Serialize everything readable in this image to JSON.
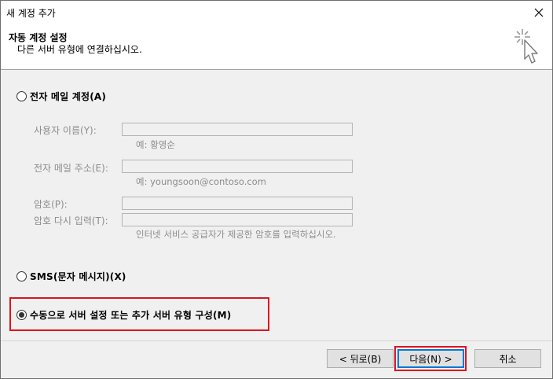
{
  "window": {
    "title": "새 계정 추가"
  },
  "header": {
    "title": "자동 계정 설정",
    "subtitle": "다른 서버 유형에 연결하십시오."
  },
  "options": {
    "email_label": "전자 메일 계정(A)",
    "sms_label": "SMS(문자 메시지)(X)",
    "manual_label": "수동으로 서버 설정 또는 추가 서버 유형 구성(M)",
    "selected": "manual"
  },
  "fields": {
    "username_label": "사용자 이름(Y):",
    "username_hint": "예: 황영순",
    "email_label": "전자 메일 주소(E):",
    "email_hint": "예: youngsoon@contoso.com",
    "password_label": "암호(P):",
    "retype_label": "암호 다시 입력(T):",
    "password_hint": "인터넷 서비스 공급자가 제공한 암호를 입력하십시오."
  },
  "buttons": {
    "back": "< 뒤로(B)",
    "next": "다음(N) >",
    "cancel": "취소"
  },
  "colors": {
    "highlight": "#e0131f",
    "focus": "#0078d7"
  }
}
